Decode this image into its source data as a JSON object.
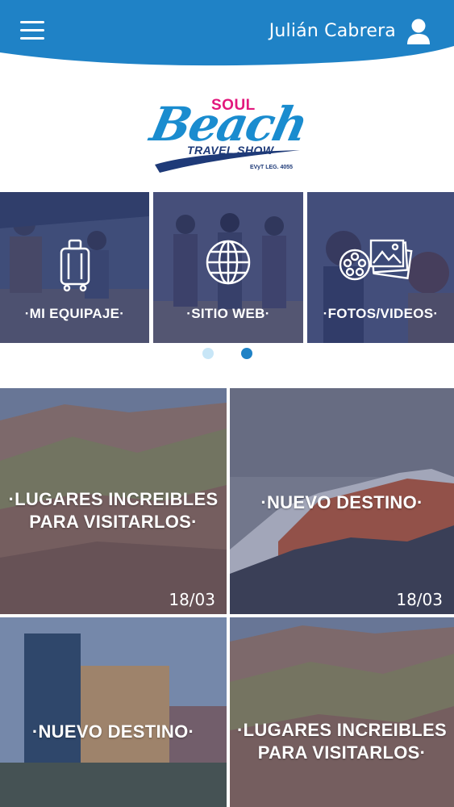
{
  "header": {
    "user_name": "Julián Cabrera",
    "menu_icon": "hamburger-menu-icon",
    "user_icon": "user-icon",
    "color": "#1f82c6"
  },
  "logo": {
    "soul": "SOUL",
    "beach": "Beach",
    "travel_show": "TRAVEL SHOW",
    "legajo": "EVyT LEG. 4055"
  },
  "quick_actions": [
    {
      "label": "·MI EQUIPAJE·",
      "icon": "luggage-icon"
    },
    {
      "label": "·SITIO WEB·",
      "icon": "globe-icon"
    },
    {
      "label": "·FOTOS/VIDEOS·",
      "icon": "photos-videos-icon"
    }
  ],
  "pager": {
    "pages": 2,
    "active_index": 1,
    "active_color": "#1f82c6",
    "inactive_color": "#c8e6f7"
  },
  "news": [
    {
      "title_line1": "·LUGARES INCREIBLES",
      "title_line2": "PARA VISITARLOS·",
      "date": "18/03"
    },
    {
      "title_line1": "·NUEVO DESTINO·",
      "title_line2": "",
      "date": "18/03"
    },
    {
      "title_line1": "·NUEVO DESTINO·",
      "title_line2": "",
      "date": ""
    },
    {
      "title_line1": "·LUGARES INCREIBLES",
      "title_line2": "PARA VISITARLOS·",
      "date": ""
    }
  ]
}
